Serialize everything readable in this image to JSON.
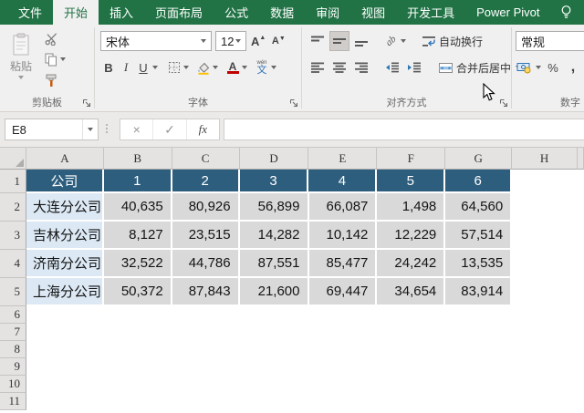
{
  "tab_bar": {
    "tabs": [
      {
        "label": "文件",
        "state": "file"
      },
      {
        "label": "开始",
        "state": "active"
      },
      {
        "label": "插入",
        "state": "normal"
      },
      {
        "label": "页面布局",
        "state": "normal"
      },
      {
        "label": "公式",
        "state": "normal"
      },
      {
        "label": "数据",
        "state": "normal"
      },
      {
        "label": "审阅",
        "state": "normal"
      },
      {
        "label": "视图",
        "state": "normal"
      },
      {
        "label": "开发工具",
        "state": "normal"
      },
      {
        "label": "Power Pivot",
        "state": "normal"
      }
    ]
  },
  "ribbon": {
    "clipboard": {
      "group_label": "剪贴板",
      "paste_label": "粘贴"
    },
    "font": {
      "group_label": "字体",
      "font_name": "宋体",
      "font_size": "12",
      "bold": "B",
      "italic": "I",
      "underline": "U",
      "phonetic_pinyin": "wén",
      "phonetic_char": "文"
    },
    "alignment": {
      "group_label": "对齐方式",
      "wrap_text": "自动换行",
      "merge_center": "合并后居中",
      "orientation_glyph": "ab"
    },
    "number": {
      "group_label": "数字",
      "format": "常规",
      "percent": "%",
      "comma": ","
    }
  },
  "formula_bar": {
    "name_box": "E8",
    "cancel": "×",
    "enter": "✓",
    "fx": "fx",
    "formula": ""
  },
  "sheet": {
    "column_headers": [
      "A",
      "B",
      "C",
      "D",
      "E",
      "F",
      "G",
      "H"
    ],
    "row_headers": [
      "1",
      "2",
      "3",
      "4",
      "5",
      "6",
      "7",
      "8",
      "9",
      "10",
      "11"
    ],
    "table": {
      "header": [
        "公司",
        "1",
        "2",
        "3",
        "4",
        "5",
        "6"
      ],
      "rows": [
        {
          "company": "大连分公司",
          "values": [
            "40,635",
            "80,926",
            "56,899",
            "66,087",
            "1,498",
            "64,560"
          ]
        },
        {
          "company": "吉林分公司",
          "values": [
            "8,127",
            "23,515",
            "14,282",
            "10,142",
            "12,229",
            "57,514"
          ]
        },
        {
          "company": "济南分公司",
          "values": [
            "32,522",
            "44,786",
            "87,551",
            "85,477",
            "24,242",
            "13,535"
          ]
        },
        {
          "company": "上海分公司",
          "values": [
            "50,372",
            "87,843",
            "21,600",
            "69,447",
            "34,654",
            "83,914"
          ]
        }
      ]
    }
  },
  "colors": {
    "excel_green": "#217346",
    "table_header_fill": "#2E5E7E",
    "company_fill": "#DCE9F5",
    "data_fill": "#D9D9D9",
    "ribbon_bg": "#F1F0F0"
  }
}
